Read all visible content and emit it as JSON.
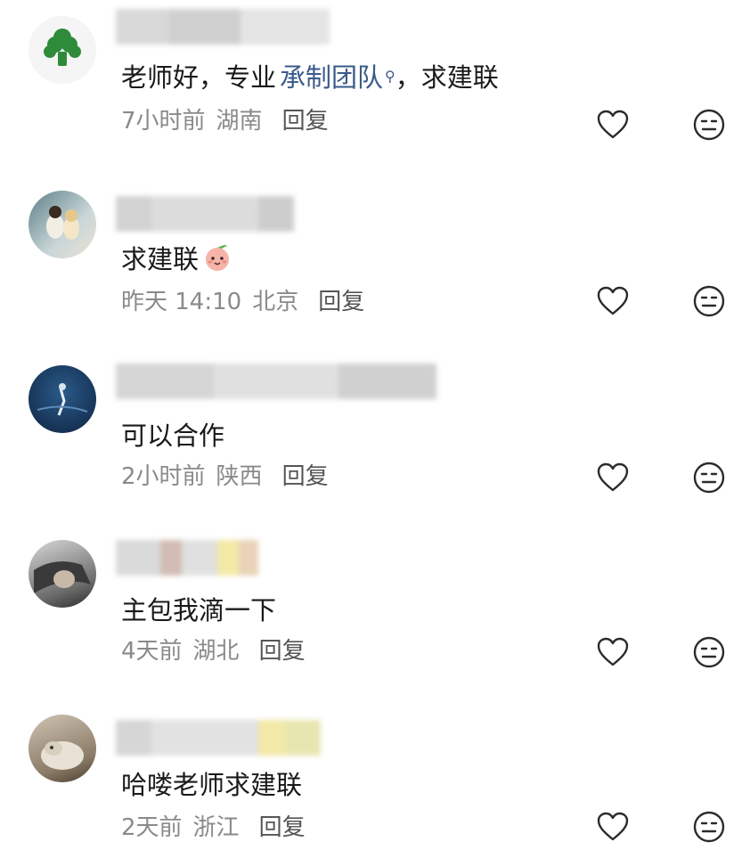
{
  "comments": [
    {
      "text_parts": [
        "老师好，专业",
        "承制团队",
        "，求建联"
      ],
      "link_text": "承制团队",
      "time": "7小时前",
      "location": "湖南",
      "reply": "回复",
      "avatar_icon": "broccoli-icon"
    },
    {
      "text": "求建联",
      "emoji": "peach-face-emoji",
      "time": "昨天 14:10",
      "location": "北京",
      "reply": "回复",
      "avatar_icon": "photo-avatar"
    },
    {
      "text": "可以合作",
      "time": "2小时前",
      "location": "陕西",
      "reply": "回复",
      "avatar_icon": "ocean-avatar"
    },
    {
      "text": "主包我滴一下",
      "time": "4天前",
      "location": "湖北",
      "reply": "回复",
      "avatar_icon": "portrait-avatar"
    },
    {
      "text": "哈喽老师求建联",
      "time": "2天前",
      "location": "浙江",
      "reply": "回复",
      "avatar_icon": "dog-avatar"
    }
  ],
  "icons": {
    "like": "heart-outline-icon",
    "dislike": "meh-face-icon"
  }
}
